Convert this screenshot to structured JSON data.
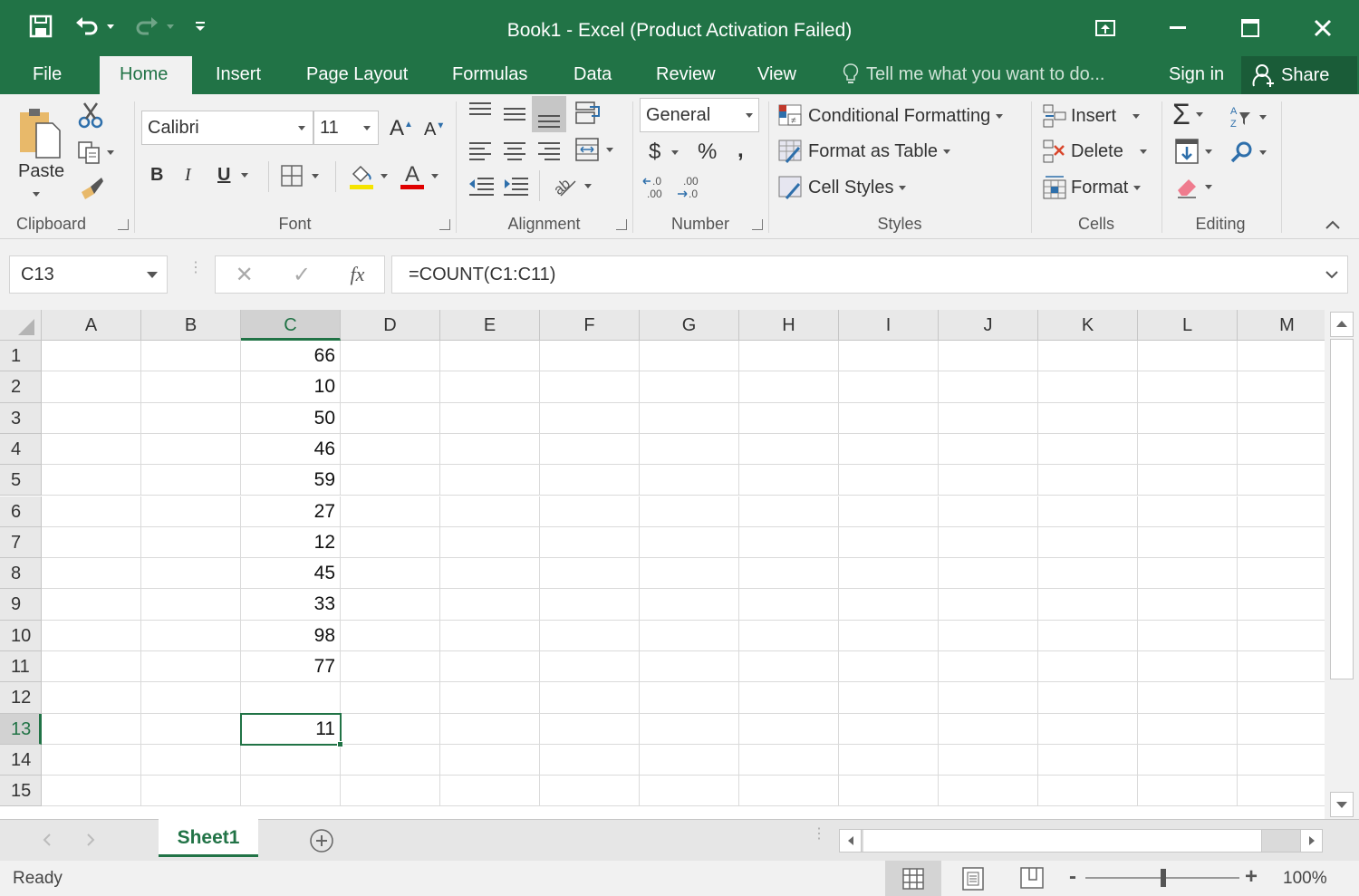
{
  "window": {
    "title": "Book1 - Excel (Product Activation Failed)"
  },
  "quick_access": {
    "icons": [
      "save-icon",
      "undo-icon",
      "redo-icon",
      "customize-qat-icon"
    ]
  },
  "ribbon_tabs": [
    {
      "label": "File"
    },
    {
      "label": "Home",
      "active": true
    },
    {
      "label": "Insert"
    },
    {
      "label": "Page Layout"
    },
    {
      "label": "Formulas"
    },
    {
      "label": "Data"
    },
    {
      "label": "Review"
    },
    {
      "label": "View"
    }
  ],
  "tell_me": "Tell me what you want to do...",
  "sign_in": "Sign in",
  "share": "Share",
  "ribbon": {
    "clipboard": {
      "label": "Clipboard",
      "paste": "Paste"
    },
    "font": {
      "label": "Font",
      "font_name": "Calibri",
      "font_size": "11",
      "bold": "B",
      "italic": "I",
      "underline": "U",
      "font_color": "#e00000",
      "fill_color": "#f5e400"
    },
    "alignment": {
      "label": "Alignment"
    },
    "number": {
      "label": "Number",
      "format": "General",
      "currency": "$",
      "percent": "%",
      "comma": ",",
      "inc_decimal": "←.0 .00",
      "dec_decimal": ".00 →.0"
    },
    "styles": {
      "label": "Styles",
      "conditional_formatting": "Conditional Formatting",
      "format_as_table": "Format as Table",
      "cell_styles": "Cell Styles"
    },
    "cells": {
      "label": "Cells",
      "insert": "Insert",
      "delete": "Delete",
      "format": "Format"
    },
    "editing": {
      "label": "Editing",
      "autosum": "Σ"
    }
  },
  "formula_bar": {
    "name_box": "C13",
    "cancel": "✕",
    "enter": "✓",
    "fx": "fx",
    "formula": "=COUNT(C1:C11)"
  },
  "sheet": {
    "columns": [
      "A",
      "B",
      "C",
      "D",
      "E",
      "F",
      "G",
      "H",
      "I",
      "J",
      "K",
      "L",
      "M"
    ],
    "rows": [
      "1",
      "2",
      "3",
      "4",
      "5",
      "6",
      "7",
      "8",
      "9",
      "10",
      "11",
      "12",
      "13",
      "14",
      "15"
    ],
    "column_c_values": [
      "66",
      "10",
      "50",
      "46",
      "59",
      "27",
      "12",
      "45",
      "33",
      "98",
      "77",
      "",
      "11",
      "",
      ""
    ],
    "selected_cell": "C13",
    "selected_column": "C",
    "selected_row": "13"
  },
  "sheet_tabs": [
    {
      "label": "Sheet1",
      "active": true
    }
  ],
  "status_bar": {
    "status": "Ready",
    "zoom": "100%",
    "zoom_minus": "-",
    "zoom_plus": "+"
  },
  "colors": {
    "accent": "#217346"
  }
}
